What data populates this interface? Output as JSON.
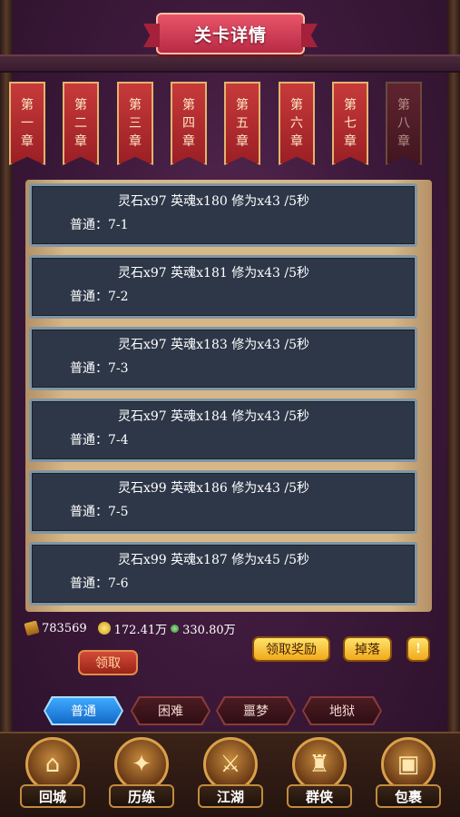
{
  "title": "关卡详情",
  "chapters": [
    {
      "chars": [
        "第",
        "一",
        "章"
      ],
      "active": true
    },
    {
      "chars": [
        "第",
        "二",
        "章"
      ],
      "active": true
    },
    {
      "chars": [
        "第",
        "三",
        "章"
      ],
      "active": true
    },
    {
      "chars": [
        "第",
        "四",
        "章"
      ],
      "active": true
    },
    {
      "chars": [
        "第",
        "五",
        "章"
      ],
      "active": true
    },
    {
      "chars": [
        "第",
        "六",
        "章"
      ],
      "active": true
    },
    {
      "chars": [
        "第",
        "七",
        "章"
      ],
      "active": true
    },
    {
      "chars": [
        "第",
        "八",
        "章"
      ],
      "active": false
    }
  ],
  "levels": [
    {
      "reward": "灵石x97 英魂x180 修为x43 /5秒",
      "stage": "普通：7-1"
    },
    {
      "reward": "灵石x97 英魂x181 修为x43 /5秒",
      "stage": "普通：7-2"
    },
    {
      "reward": "灵石x97 英魂x183 修为x43 /5秒",
      "stage": "普通：7-3"
    },
    {
      "reward": "灵石x97 英魂x184 修为x43 /5秒",
      "stage": "普通：7-4"
    },
    {
      "reward": "灵石x99 英魂x186 修为x43 /5秒",
      "stage": "普通：7-5"
    },
    {
      "reward": "灵石x99 英魂x187 修为x45 /5秒",
      "stage": "普通：7-6"
    }
  ],
  "resources": {
    "scroll": "783569",
    "coin": "172.41万",
    "gem": "330.80万"
  },
  "buttons": {
    "collect_all": "领取奖励",
    "drop": "掉落",
    "info": "!",
    "claim": "领取"
  },
  "tabs": [
    {
      "label": "普通",
      "active": true
    },
    {
      "label": "困难",
      "active": false
    },
    {
      "label": "噩梦",
      "active": false
    },
    {
      "label": "地狱",
      "active": false
    }
  ],
  "nav": [
    {
      "label": "回城",
      "icon": "castle-icon"
    },
    {
      "label": "历练",
      "icon": "map-icon"
    },
    {
      "label": "江湖",
      "icon": "weapons-icon"
    },
    {
      "label": "群侠",
      "icon": "helmet-icon"
    },
    {
      "label": "包裹",
      "icon": "bag-icon"
    }
  ]
}
